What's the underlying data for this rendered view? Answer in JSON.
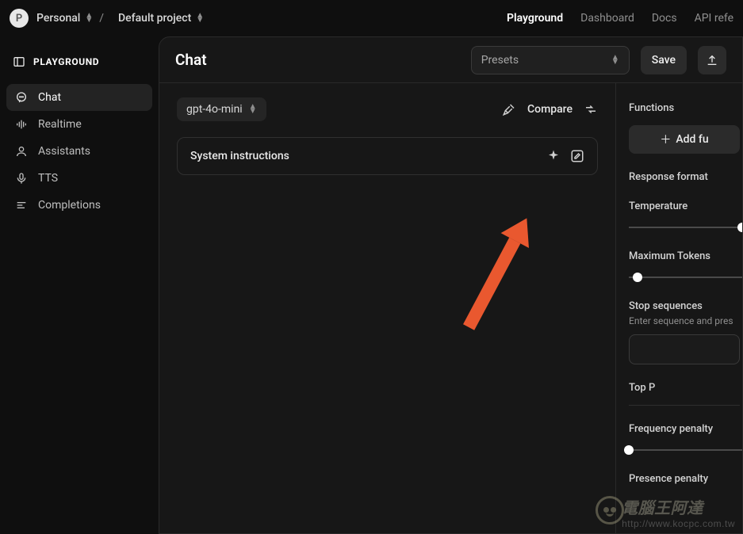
{
  "topbar": {
    "avatar_initial": "P",
    "workspace": "Personal",
    "project": "Default project",
    "nav": {
      "playground": "Playground",
      "dashboard": "Dashboard",
      "docs": "Docs",
      "api_reference": "API refe"
    }
  },
  "sidebar": {
    "heading": "PLAYGROUND",
    "items": {
      "chat": "Chat",
      "realtime": "Realtime",
      "assistants": "Assistants",
      "tts": "TTS",
      "completions": "Completions"
    }
  },
  "main": {
    "title": "Chat",
    "presets_label": "Presets",
    "save_label": "Save",
    "model": "gpt-4o-mini",
    "compare_label": "Compare",
    "system_instructions_label": "System instructions"
  },
  "right": {
    "functions_label": "Functions",
    "add_function_label": "Add fu",
    "response_format_label": "Response format",
    "temperature_label": "Temperature",
    "max_tokens_label": "Maximum Tokens",
    "stop_sequences_label": "Stop sequences",
    "stop_sequences_hint": "Enter sequence and pres",
    "top_p_label": "Top P",
    "frequency_penalty_label": "Frequency penalty",
    "presence_penalty_label": "Presence penalty",
    "sliders": {
      "temperature_pos_pct": 100,
      "max_tokens_pos_pct": 8,
      "frequency_pos_pct": 0
    }
  },
  "watermark": {
    "text_cn": "電腦王阿達",
    "url": "http://www.kocpc.com.tw"
  }
}
